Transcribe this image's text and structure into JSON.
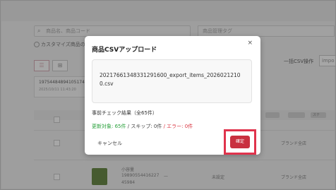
{
  "background": {
    "search_placeholder": "商品名、商品コード",
    "tag_placeholder": "商品管理タグ",
    "customize_label": "カスタマイズ商品の",
    "bulk_csv_label": "一括CSV操作",
    "import_select": "impo",
    "item_id": "19754484894105174",
    "item_date": "2025/10/11 11:43:20",
    "header_badges": [
      "",
      "",
      "",
      "",
      "",
      "",
      "",
      "",
      "",
      ""
    ],
    "status_col": "ステ",
    "row_texts": [
      "ブランド全店",
      "ブランド全店"
    ],
    "product_name": "小容量",
    "product_code": "19890554416227",
    "product_code2": "45984",
    "dash": "—",
    "status_unpublished": "未設定"
  },
  "modal": {
    "title": "商品CSVアップロード",
    "close_icon": "×",
    "file_name": "20217661348331291600_export_items_20260212100.csv",
    "precheck": "事前チェック結果（全65件）",
    "update_target": "更新対象: 65件",
    "skip": "/ スキップ: 0件",
    "error": "/ エラー: 0件",
    "cancel_label": "キャンセル",
    "confirm_label": "確定"
  },
  "colors": {
    "success": "#27a03a",
    "error": "#d9333f",
    "confirm": "#c9303f",
    "highlight": "#e0334c"
  }
}
